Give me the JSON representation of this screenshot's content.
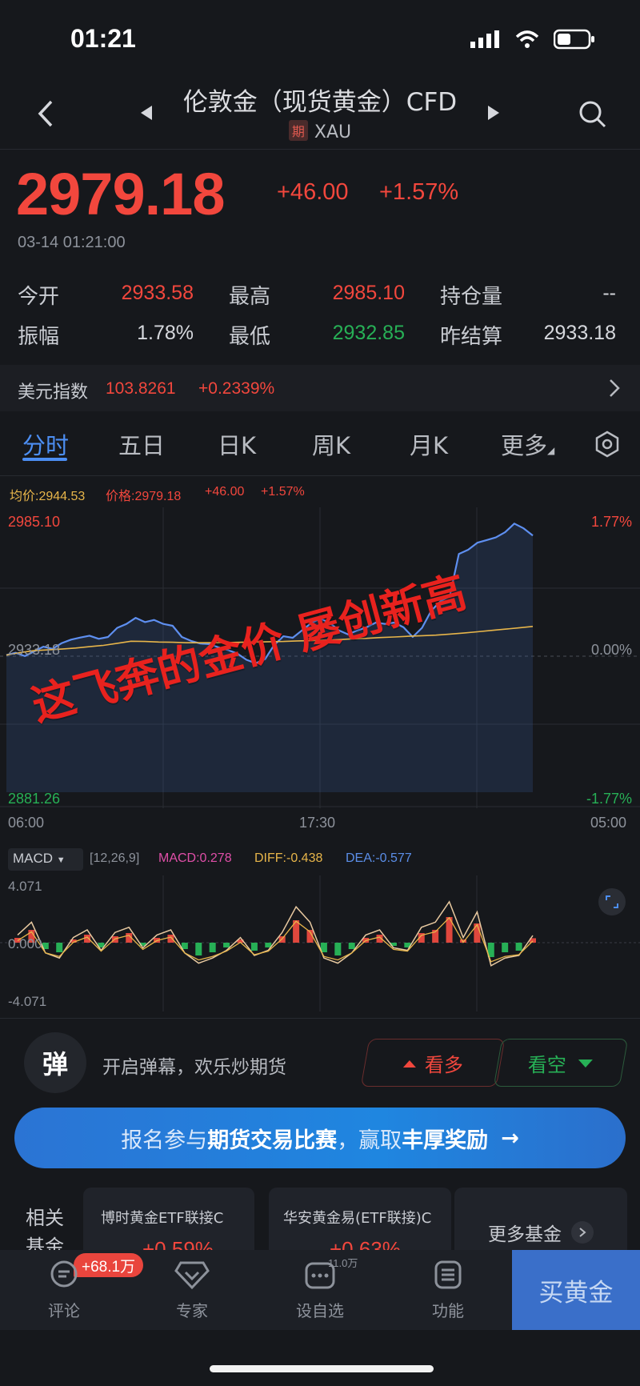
{
  "status": {
    "time": "01:21"
  },
  "header": {
    "title": "伦敦金（现货黄金）CFD",
    "badge": "期",
    "symbol": "XAU"
  },
  "quote": {
    "price": "2979.18",
    "change": "+46.00",
    "change_pct": "+1.57%",
    "timestamp": "03-14 01:21:00"
  },
  "stats": [
    {
      "label": "今开",
      "value": "2933.58",
      "color": "red"
    },
    {
      "label": "最高",
      "value": "2985.10",
      "color": "red"
    },
    {
      "label": "持仓量",
      "value": "--",
      "color": "light"
    },
    {
      "label": "振幅",
      "value": "1.78%",
      "color": "light"
    },
    {
      "label": "最低",
      "value": "2932.85",
      "color": "green"
    },
    {
      "label": "昨结算",
      "value": "2933.18",
      "color": "light"
    }
  ],
  "dxy": {
    "label": "美元指数",
    "value": "103.8261",
    "change": "+0.2339%"
  },
  "tabs": [
    "分时",
    "五日",
    "日K",
    "周K",
    "月K",
    "更多"
  ],
  "chart_legend": {
    "avg": "均价:2944.53",
    "price": "价格:2979.18",
    "change": "+46.00",
    "change_pct": "+1.57%"
  },
  "chart_labels": {
    "y_top": "2985.10",
    "y_mid": "2933.18",
    "y_bottom": "2881.26",
    "pct_top": "1.77%",
    "pct_mid": "0.00%",
    "pct_bottom": "-1.77%",
    "x_start": "06:00",
    "x_mid": "17:30",
    "x_end": "05:00"
  },
  "overlay": "这飞奔的金价 屡创新高",
  "macd": {
    "name": "MACD",
    "params": "[12,26,9]",
    "macd": "MACD:0.278",
    "diff": "DIFF:-0.438",
    "dea": "DEA:-0.577",
    "y_top": "4.071",
    "y_mid": "0.000",
    "y_bottom": "-4.071"
  },
  "danmu": {
    "icon": "弹",
    "text": "开启弹幕，欢乐炒期货",
    "bull": "看多",
    "bear": "看空"
  },
  "banner": {
    "prefix": "报名参与",
    "bold1": "期货交易比赛",
    "mid": "，赢取",
    "bold2": "丰厚奖励",
    "arrow": "→"
  },
  "funds": {
    "label1": "相关",
    "label2": "基金",
    "cards": [
      {
        "name": "博时黄金ETF联接C",
        "pct": "+0.59%"
      },
      {
        "name": "华安黄金易(ETF联接)C",
        "pct": "+0.63%"
      }
    ],
    "more": "更多基金"
  },
  "bottom_tabs": [
    {
      "label": "评论",
      "badge": "+68.1万"
    },
    {
      "label": "专家"
    },
    {
      "label": "设自选",
      "badge": "11.0万"
    },
    {
      "label": "功能"
    }
  ],
  "buy": "买黄金",
  "chart_data": {
    "type": "line",
    "ylim": [
      2881.26,
      2985.1
    ],
    "series": [
      {
        "name": "价格",
        "values": [
          2933.6,
          2934.5,
          2933.2,
          2935.0,
          2936.8,
          2936.0,
          2938.2,
          2939.5,
          2940.3,
          2941.0,
          2939.8,
          2940.5,
          2944.0,
          2945.5,
          2947.8,
          2946.2,
          2947.0,
          2945.5,
          2944.8,
          2940.5,
          2939.0,
          2938.0,
          2937.8,
          2936.5,
          2935.5,
          2934.2,
          2931.8,
          2930.5,
          2932.0,
          2937.5,
          2940.8,
          2940.2,
          2943.0,
          2945.8,
          2947.5,
          2946.0,
          2943.0,
          2941.5,
          2943.0,
          2944.2,
          2946.0,
          2945.5,
          2946.0,
          2944.2,
          2940.5,
          2944.0,
          2950.5,
          2954.2,
          2956.0,
          2972.2,
          2973.8,
          2976.5,
          2977.5,
          2978.5,
          2980.5,
          2983.8,
          2982.0,
          2979.2
        ]
      },
      {
        "name": "均价",
        "values": [
          2933.6,
          2934.6,
          2935.3,
          2935.6,
          2935.9,
          2936.3,
          2936.8,
          2937.3,
          2938.1,
          2938.9,
          2938.8,
          2938.6,
          2938.5,
          2938.3,
          2938.3,
          2938.3,
          2938.4,
          2938.5,
          2938.6,
          2938.7,
          2938.8,
          2939.0,
          2939.1,
          2939.3,
          2939.5,
          2939.8,
          2940.0,
          2940.3,
          2940.5,
          2940.8,
          2941.0,
          2941.2,
          2941.6,
          2942.0,
          2942.5,
          2943.0,
          2943.5,
          2944.0,
          2944.53
        ]
      }
    ],
    "macd": [
      0.3,
      0.8,
      -0.4,
      -0.6,
      0.2,
      0.5,
      -0.3,
      0.4,
      0.6,
      -0.2,
      0.3,
      0.5,
      -0.4,
      -0.8,
      -0.6,
      -0.3,
      0.2,
      -0.5,
      -0.3,
      0.4,
      1.4,
      0.8,
      -0.6,
      -0.8,
      -0.4,
      0.3,
      0.5,
      -0.2,
      -0.3,
      0.6,
      0.8,
      1.6,
      0.2,
      1.2,
      -0.9,
      -0.6,
      -0.5,
      0.278
    ]
  }
}
